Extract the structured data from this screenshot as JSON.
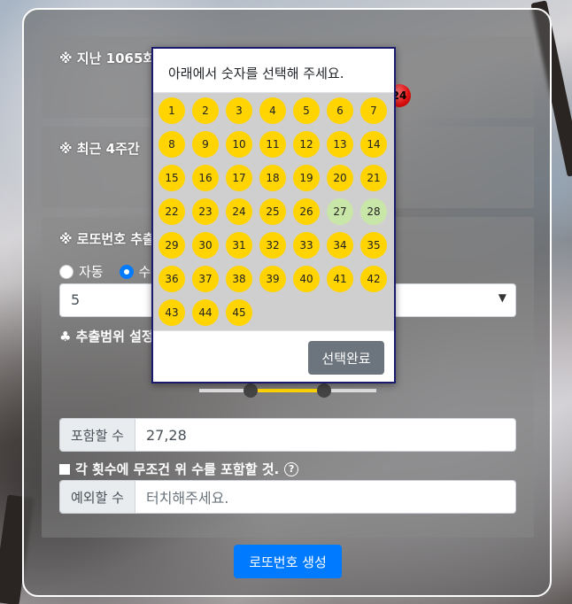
{
  "sections": {
    "last_draw_title": "※ 지난 1065회",
    "last_draw_bonus_ball": "24",
    "recent_weeks_title": "※ 최근 4주간 ",
    "extract_title": "※ 로또번호 추출"
  },
  "mode": {
    "auto_label": "자동",
    "semi_label": "수",
    "selected": "semi"
  },
  "count_select": {
    "value": "5"
  },
  "range_label": "♣ 추출범위 설정",
  "slider": {
    "min_fraction": 0.29,
    "max_fraction": 0.71
  },
  "include": {
    "addon": "포함할 수",
    "value": "27,28"
  },
  "always_include": {
    "label": "각 횟수에 무조건 위 수를 포함할 것.",
    "help_glyph": "?"
  },
  "exclude": {
    "addon": "예외할 수",
    "placeholder": "터치해주세요."
  },
  "generate_button": "로또번호 생성",
  "modal": {
    "title": "아래에서 숫자를 선택해 주세요.",
    "numbers": [
      "1",
      "2",
      "3",
      "4",
      "5",
      "6",
      "7",
      "8",
      "9",
      "10",
      "11",
      "12",
      "13",
      "14",
      "15",
      "16",
      "17",
      "18",
      "19",
      "20",
      "21",
      "22",
      "23",
      "24",
      "25",
      "26",
      "27",
      "28",
      "29",
      "30",
      "31",
      "32",
      "33",
      "34",
      "35",
      "36",
      "37",
      "38",
      "39",
      "40",
      "41",
      "42",
      "43",
      "44",
      "45"
    ],
    "selected": [
      "27",
      "28"
    ],
    "done_button": "선택완료",
    "colors": {
      "ball": "#ffd400",
      "ball_selected": "#c8e6a8"
    }
  },
  "colors": {
    "primary": "#007bff",
    "secondary": "#6c757d"
  }
}
